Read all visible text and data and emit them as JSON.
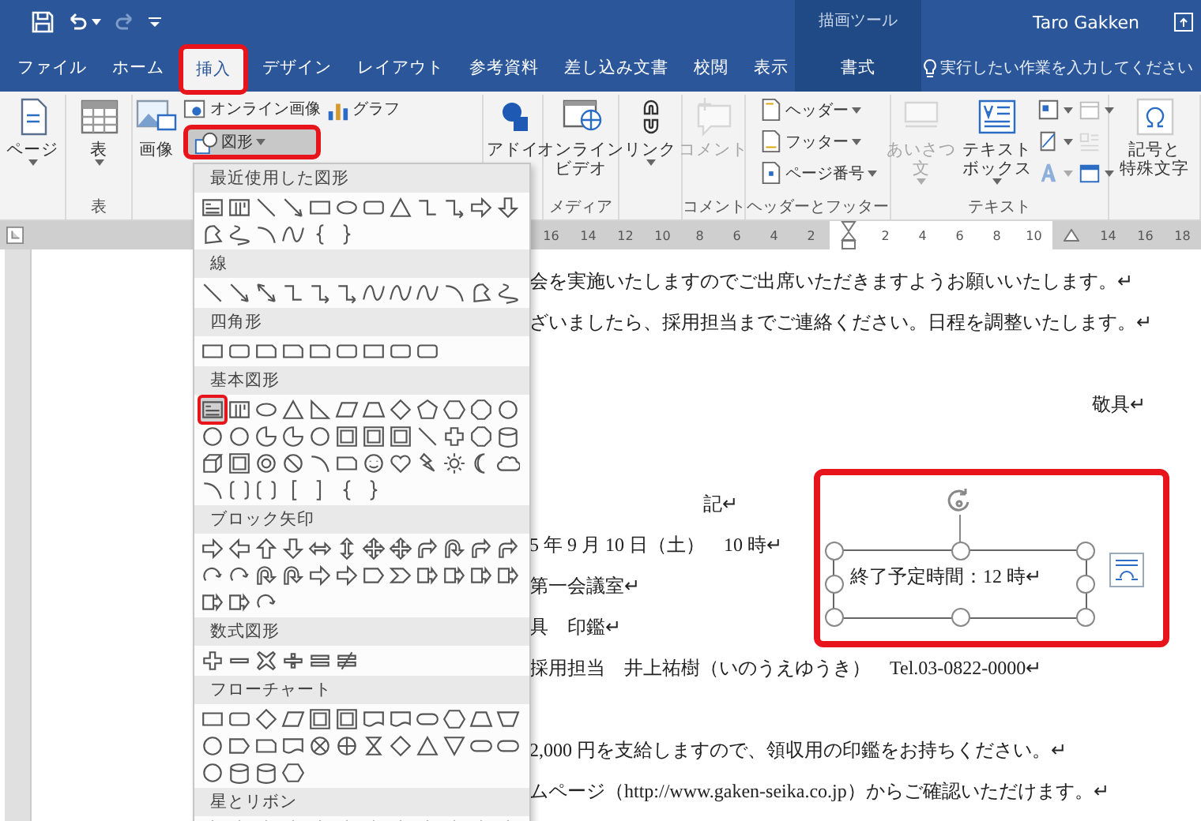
{
  "title_bar": {
    "redo_disabled": true,
    "context_label": "描画ツール",
    "user": "Taro Gakken"
  },
  "tabs": [
    {
      "label": "ファイル",
      "selected": false,
      "contextual": false,
      "callout": false
    },
    {
      "label": "ホーム",
      "selected": false,
      "contextual": false,
      "callout": false
    },
    {
      "label": "挿入",
      "selected": true,
      "contextual": false,
      "callout": true
    },
    {
      "label": "デザイン",
      "selected": false,
      "contextual": false,
      "callout": false
    },
    {
      "label": "レイアウト",
      "selected": false,
      "contextual": false,
      "callout": false
    },
    {
      "label": "参考資料",
      "selected": false,
      "contextual": false,
      "callout": false
    },
    {
      "label": "差し込み文書",
      "selected": false,
      "contextual": false,
      "callout": false
    },
    {
      "label": "校閲",
      "selected": false,
      "contextual": false,
      "callout": false
    },
    {
      "label": "表示",
      "selected": false,
      "contextual": false,
      "callout": false
    },
    {
      "label": "書式",
      "selected": false,
      "contextual": true,
      "callout": false
    }
  ],
  "tell_me": {
    "placeholder": "実行したい作業を入力してください"
  },
  "ribbon": {
    "groups": [
      {
        "items": [
          {
            "kind": "large",
            "lines": [
              "ページ"
            ],
            "caret": true,
            "disabled": false,
            "callout": false
          }
        ]
      },
      {
        "label": "表",
        "items": [
          {
            "kind": "large",
            "lines": [
              "表"
            ],
            "caret": true,
            "disabled": false,
            "callout": false
          }
        ]
      },
      {
        "items": [
          {
            "kind": "large",
            "lines": [
              "画像"
            ],
            "caret": false,
            "disabled": false,
            "callout": false
          },
          {
            "kind": "small",
            "label": "オンライン画像",
            "caret": false,
            "disabled": false,
            "callout": false
          },
          {
            "kind": "small",
            "label": "図形",
            "caret": true,
            "disabled": false,
            "callout": true
          },
          {
            "kind": "small",
            "label": "グラフ",
            "caret": false,
            "disabled": false,
            "callout": false
          }
        ]
      },
      {
        "items": [
          {
            "kind": "large",
            "lines": [
              "アドイ"
            ],
            "caret": false,
            "disabled": false,
            "callout": false
          }
        ]
      },
      {
        "label": "メディア",
        "items": [
          {
            "kind": "large",
            "lines": [
              "オンライン",
              "ビデオ"
            ],
            "caret": false,
            "disabled": false,
            "callout": false
          }
        ]
      },
      {
        "items": [
          {
            "kind": "large",
            "lines": [
              "リンク"
            ],
            "caret": true,
            "disabled": false,
            "callout": false
          }
        ]
      },
      {
        "label": "コメント",
        "items": [
          {
            "kind": "large",
            "lines": [
              "コメント"
            ],
            "caret": false,
            "disabled": true,
            "callout": false
          }
        ]
      },
      {
        "label": "ヘッダーとフッター",
        "items": [
          {
            "kind": "small",
            "label": "ヘッダー",
            "caret": true,
            "disabled": false,
            "callout": false
          },
          {
            "kind": "small",
            "label": "フッター",
            "caret": true,
            "disabled": false,
            "callout": false
          },
          {
            "kind": "small",
            "label": "ページ番号",
            "caret": true,
            "disabled": false,
            "callout": false
          }
        ]
      },
      {
        "label": "テキスト",
        "items": [
          {
            "kind": "large",
            "lines": [
              "あいさつ",
              "文"
            ],
            "caret": true,
            "disabled": true,
            "callout": false
          },
          {
            "kind": "large",
            "lines": [
              "テキスト",
              "ボックス"
            ],
            "caret": true,
            "disabled": false,
            "callout": false
          },
          {
            "kind": "icon",
            "caret": true,
            "disabled": false,
            "callout": false
          },
          {
            "kind": "icon",
            "caret": true,
            "disabled": false,
            "callout": false
          },
          {
            "kind": "icon",
            "caret": true,
            "disabled": true,
            "callout": false
          },
          {
            "kind": "icon",
            "caret": true,
            "disabled": false,
            "callout": false
          },
          {
            "kind": "icon",
            "caret": false,
            "disabled": true,
            "callout": false
          },
          {
            "kind": "icon",
            "caret": true,
            "disabled": false,
            "callout": false
          }
        ]
      },
      {
        "items": [
          {
            "kind": "large",
            "lines": [
              "記号と",
              "特殊文字"
            ],
            "caret": false,
            "disabled": false,
            "callout": false
          }
        ]
      }
    ]
  },
  "ruler": {
    "items": [
      {
        "kind": "number",
        "label": "16",
        "margin": true
      },
      {
        "kind": "number",
        "label": "14",
        "margin": true
      },
      {
        "kind": "number",
        "label": "12",
        "margin": true
      },
      {
        "kind": "number",
        "label": "10",
        "margin": true
      },
      {
        "kind": "number",
        "label": "8",
        "margin": true
      },
      {
        "kind": "number",
        "label": "6",
        "margin": true
      },
      {
        "kind": "number",
        "label": "4",
        "margin": true
      },
      {
        "kind": "number",
        "label": "2",
        "margin": true
      },
      {
        "kind": "first_indent",
        "margin": false
      },
      {
        "kind": "number",
        "label": "2",
        "margin": false
      },
      {
        "kind": "number",
        "label": "4",
        "margin": false
      },
      {
        "kind": "number",
        "label": "6",
        "margin": false
      },
      {
        "kind": "number",
        "label": "8",
        "margin": false
      },
      {
        "kind": "number",
        "label": "10",
        "margin": false
      },
      {
        "kind": "right_indent",
        "margin": true
      },
      {
        "kind": "number",
        "label": "14",
        "margin": true
      },
      {
        "kind": "number",
        "label": "16",
        "margin": true
      },
      {
        "kind": "number",
        "label": "18",
        "margin": true
      }
    ]
  },
  "document": {
    "lines": [
      {
        "kind": "body",
        "text": "会を実施いたしますのでご出席いただきますようお願いいたします。↵",
        "gap_before": false
      },
      {
        "kind": "body",
        "text": "ざいましたら、採用担当までご連絡ください。日程を調整いたします。↵",
        "gap_before": false
      },
      {
        "kind": "closing",
        "text": "敬具↵",
        "gap_before": true
      },
      {
        "kind": "heading",
        "text": "記↵",
        "gap_before": true
      },
      {
        "kind": "body",
        "text": "5 年 9 月 10 日（土）　10 時↵",
        "gap_before": false
      },
      {
        "kind": "body",
        "text": "第一会議室↵",
        "gap_before": false
      },
      {
        "kind": "body",
        "text": "具　印鑑↵",
        "gap_before": false
      },
      {
        "kind": "body",
        "text": "採用担当　井上祐樹（いのうえゆうき）　Tel.03-0822-0000↵",
        "gap_before": false
      },
      {
        "kind": "body",
        "text": "2,000 円を支給しますので、領収用の印鑑をお持ちください。↵",
        "gap_before": true
      },
      {
        "kind": "body",
        "text": "ムページ（http://www.gaken-seika.co.jp）からご確認いただけます。↵",
        "gap_before": false
      }
    ],
    "text_box": {
      "text": "終了予定時間：12 時↵",
      "callout": true
    }
  },
  "shapes_menu": {
    "sections": [
      {
        "title": "最近使用した図形",
        "callout": false
      },
      {
        "title": "線",
        "callout": false
      },
      {
        "title": "四角形",
        "callout": false
      },
      {
        "title": "基本図形",
        "callout": true
      },
      {
        "title": "ブロック矢印",
        "callout": false
      },
      {
        "title": "数式図形",
        "callout": false
      },
      {
        "title": "フローチャート",
        "callout": false
      },
      {
        "title": "星とリボン",
        "callout": false
      }
    ]
  }
}
